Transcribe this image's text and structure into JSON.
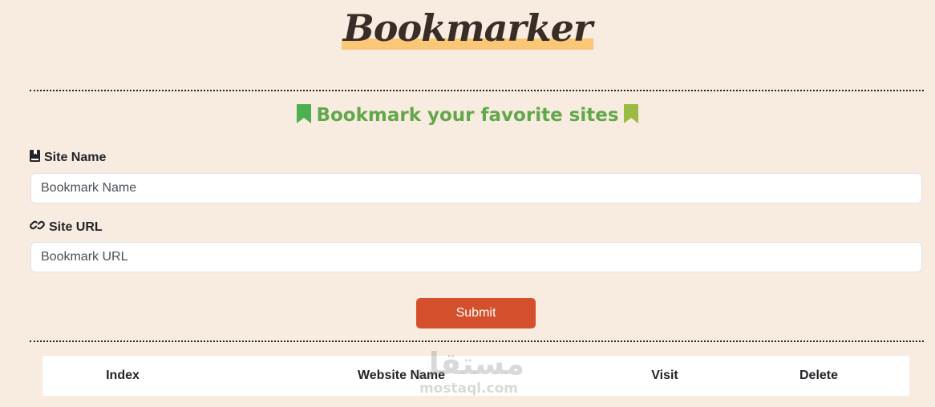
{
  "header": {
    "brand": "Bookmarker"
  },
  "form": {
    "subtitle": "Bookmark your favorite sites",
    "site_name": {
      "label": "Site Name",
      "placeholder": "Bookmark Name"
    },
    "site_url": {
      "label": "Site URL",
      "placeholder": "Bookmark URL"
    },
    "submit_label": "Submit"
  },
  "table": {
    "headers": [
      "Index",
      "Website Name",
      "Visit",
      "Delete"
    ]
  },
  "watermark": {
    "arabic": "مستقل",
    "latin": "mostaql.com"
  },
  "colors": {
    "background": "#f8ebdf",
    "brand_highlight": "#f7c46c",
    "subtitle_green": "#5aab4f",
    "submit_button": "#d4502c"
  },
  "icons": {
    "subtitle_left": "bookmark-icon",
    "subtitle_right": "bookmark-icon",
    "site_name": "book-icon",
    "site_url": "link-icon"
  }
}
